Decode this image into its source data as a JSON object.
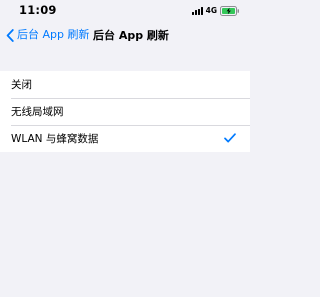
{
  "status_bar": {
    "time": "11:09",
    "network": "4G",
    "signal_icon": "signal-bars-icon",
    "battery_icon": "battery-charging-icon"
  },
  "nav": {
    "back_label": "后台 App 刷新",
    "title": "后台 App 刷新",
    "back_icon": "chevron-left-icon"
  },
  "options": [
    {
      "label": "关闭",
      "selected": false
    },
    {
      "label": "无线局域网",
      "selected": false
    },
    {
      "label": "WLAN 与蜂窝数据",
      "selected": true
    }
  ],
  "colors": {
    "accent": "#007aff",
    "background": "#f2f2f7",
    "battery": "#34c759"
  }
}
